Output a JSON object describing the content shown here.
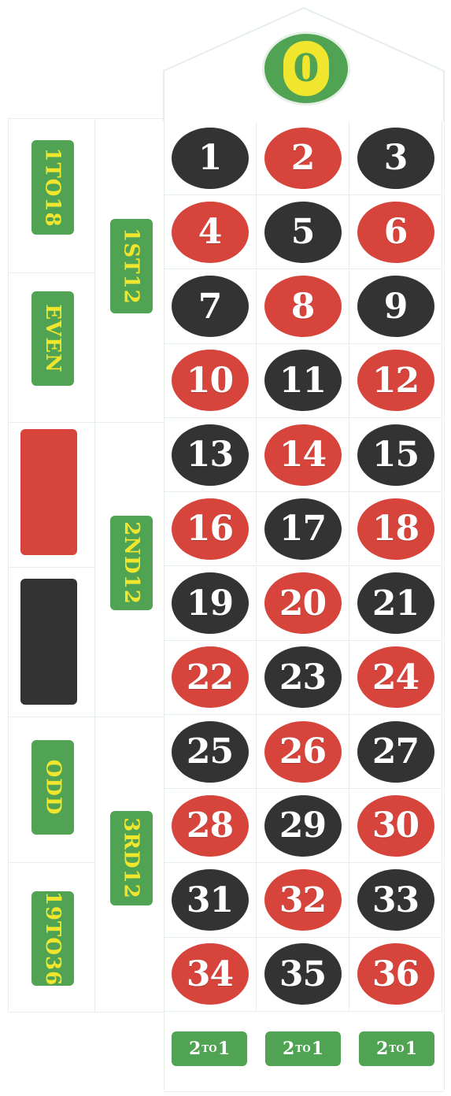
{
  "zero": {
    "label": "0"
  },
  "numbers": [
    {
      "n": "1",
      "color": "black"
    },
    {
      "n": "2",
      "color": "red"
    },
    {
      "n": "3",
      "color": "black"
    },
    {
      "n": "4",
      "color": "red"
    },
    {
      "n": "5",
      "color": "black"
    },
    {
      "n": "6",
      "color": "red"
    },
    {
      "n": "7",
      "color": "black"
    },
    {
      "n": "8",
      "color": "red"
    },
    {
      "n": "9",
      "color": "black"
    },
    {
      "n": "10",
      "color": "red"
    },
    {
      "n": "11",
      "color": "black"
    },
    {
      "n": "12",
      "color": "red"
    },
    {
      "n": "13",
      "color": "black"
    },
    {
      "n": "14",
      "color": "red"
    },
    {
      "n": "15",
      "color": "black"
    },
    {
      "n": "16",
      "color": "red"
    },
    {
      "n": "17",
      "color": "black"
    },
    {
      "n": "18",
      "color": "red"
    },
    {
      "n": "19",
      "color": "black"
    },
    {
      "n": "20",
      "color": "red"
    },
    {
      "n": "21",
      "color": "black"
    },
    {
      "n": "22",
      "color": "red"
    },
    {
      "n": "23",
      "color": "black"
    },
    {
      "n": "24",
      "color": "red"
    },
    {
      "n": "25",
      "color": "black"
    },
    {
      "n": "26",
      "color": "red"
    },
    {
      "n": "27",
      "color": "black"
    },
    {
      "n": "28",
      "color": "red"
    },
    {
      "n": "29",
      "color": "black"
    },
    {
      "n": "30",
      "color": "red"
    },
    {
      "n": "31",
      "color": "black"
    },
    {
      "n": "32",
      "color": "red"
    },
    {
      "n": "33",
      "color": "black"
    },
    {
      "n": "34",
      "color": "red"
    },
    {
      "n": "35",
      "color": "black"
    },
    {
      "n": "36",
      "color": "red"
    }
  ],
  "outside": {
    "low": "1TO18",
    "even": "EVEN",
    "odd": "ODD",
    "high": "19TO36",
    "dozen1": "1ST12",
    "dozen2": "2ND12",
    "dozen3": "3RD12"
  },
  "columns": [
    {
      "label_a": "2",
      "label_to": "TO",
      "label_b": "1"
    },
    {
      "label_a": "2",
      "label_to": "TO",
      "label_b": "1"
    },
    {
      "label_a": "2",
      "label_to": "TO",
      "label_b": "1"
    }
  ],
  "colors": {
    "green": "#4fa352",
    "yellow": "#f1e62e",
    "red": "#d6443b",
    "black": "#333333"
  }
}
